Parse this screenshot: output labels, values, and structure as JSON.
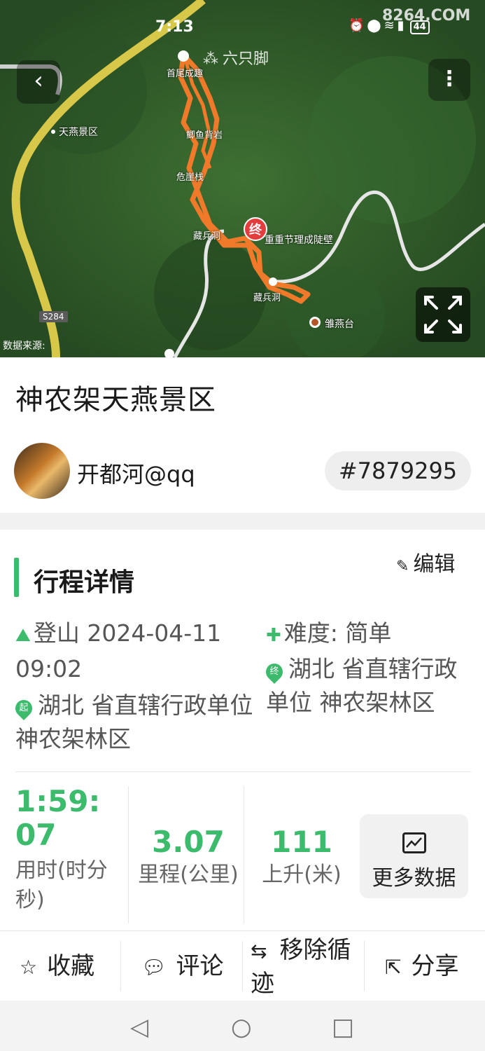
{
  "status_bar": {
    "time": "7:13",
    "battery": "44",
    "watermark": "8264.COM"
  },
  "map": {
    "brand": "六只脚",
    "labels": {
      "scenic_area": "天燕景区",
      "road": "S284",
      "point_1": "鲫鱼背岩",
      "point_2": "危崖栈",
      "point_3": "重重节理成陡壁",
      "point_4": "雏燕台",
      "point_5": "藏兵洞",
      "point_6": "首尾成趣",
      "end_marker": "终"
    },
    "data_source": "数据来源:"
  },
  "title": "神农架天燕景区",
  "user": {
    "name": "开都河@qq",
    "track_id": "#7879295"
  },
  "details": {
    "section_title": "行程详情",
    "edit_label": "编辑",
    "activity": "登山 2024-04-11 09:02",
    "difficulty": "难度: 简单",
    "start_marker": "起",
    "start_location": "湖北 省直辖行政单位 神农架林区",
    "end_marker": "终",
    "end_location": "湖北 省直辖行政单位 神农架林区"
  },
  "stats": {
    "duration_value": "1:59:07",
    "duration_label": "用时(时分秒)",
    "distance_value": "3.07",
    "distance_label": "里程(公里)",
    "ascent_value": "111",
    "ascent_label": "上升(米)",
    "more_data_label": "更多数据"
  },
  "actions": {
    "favorite": "收藏",
    "comment": "评论",
    "remove_loop": "移除循迹",
    "share": "分享"
  },
  "colors": {
    "accent": "#3dbb6c",
    "track": "#f07a2a"
  }
}
